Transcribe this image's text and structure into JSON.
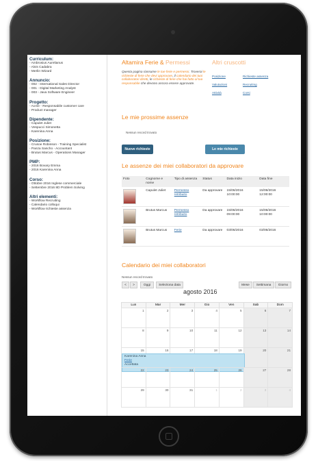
{
  "sidebar": {
    "sections": [
      {
        "title": "Curriculum:",
        "items": [
          "- Ambrosius Aurelianus",
          "- Alvis Cadabra",
          "- Merlin Wizard"
        ]
      },
      {
        "title": "Annuncio:",
        "items": [
          "- 002 - International Sales Director",
          "- 001 - Digital Marketing Analyst",
          "- 003 - Java Software Engineer"
        ]
      },
      {
        "title": "Progetto:",
        "items": [
          "- Acme - Responsabile customer care",
          "- Product manager"
        ]
      },
      {
        "title": "Dipendente:",
        "items": [
          "- Capulet Juliet",
          "- Vespucci Simonetta",
          "- Karenina Anna"
        ]
      },
      {
        "title": "Posizione:",
        "items": [
          "- Crusoe Robinson - Training Specialist",
          "- Panza Sancho - Accountant",
          "- Brutus Marcus - Operations Manager"
        ]
      },
      {
        "title": "PMP:",
        "items": [
          "- 2016 Bovary Emma",
          "- 2016 Karenina Anna"
        ]
      },
      {
        "title": "Corso:",
        "items": [
          "- Ottobre 2016 Inglese commerciale",
          "- Settembre 2016 8D Problem Solving"
        ]
      },
      {
        "title": "Altri elementi:",
        "items": [
          "- Workflow Recruiting",
          "- Calendario colloqui",
          "- Workflow richieste assenza"
        ]
      }
    ]
  },
  "header": {
    "title_main": "Altamira Ferie &",
    "title_light": "Permessi",
    "other": "Altri cruscotti"
  },
  "description": {
    "before": "Questa pagina riassume",
    "hl1": "le tue ferie e permessi",
    "mid1": ". Troverai",
    "hl2": "le richieste di ferie che devi approvare",
    "mid2": ", il",
    "hl3": "calendario dei tuoi collaboratori diretti",
    "mid3": ", le",
    "hl4": "richieste di ferie che hai fatto al tuo responsabile",
    "after": " che devono ancora essere approvate."
  },
  "links": {
    "col1": [
      "Posizione",
      "Valutazioni",
      "Attività"
    ],
    "col2": [
      "Richieste assenza",
      "Recruiting",
      "Corsi"
    ]
  },
  "upcoming": {
    "title": "Le mie prossime assenze",
    "empty": "Nessun record trovato",
    "btn_new": "Nuove richieste",
    "btn_mine": "Le mie richieste"
  },
  "approvals": {
    "title": "Le assenze dei miei collaboratori da approvare",
    "headers": [
      "Foto",
      "Cognome e nome",
      "Tipo di assenza",
      "Status",
      "Data inizio",
      "Data fine"
    ],
    "rows": [
      {
        "name": "Capulet Juliet",
        "type": "Permesso retribuito",
        "status": "Da approvare",
        "start": "15/06/2016 10:00:00",
        "end": "15/06/2016 12:00:00",
        "photo": "#a2362f"
      },
      {
        "name": "Brutus Marcus",
        "type": "Permesso retribuito",
        "status": "Da approvare",
        "start": "15/06/2016 09:00:00",
        "end": "15/06/2016 10:00:00",
        "photo": "#8a6d55"
      },
      {
        "name": "Brutus Marcus",
        "type": "Ferie",
        "status": "Da approvare",
        "start": "03/06/2016",
        "end": "03/06/2016",
        "photo": "#8a6d55"
      }
    ]
  },
  "calendar": {
    "title": "Calendario dei miei collaboratori",
    "empty": "Nessun record trovato",
    "prev": "<",
    "next": ">",
    "today": "Oggi",
    "select": "Seleziona data",
    "views": [
      "Mese",
      "Settimana",
      "Giorno"
    ],
    "month": "agosto 2016",
    "days": [
      "Lun",
      "Mar",
      "Mer",
      "Gio",
      "Ven",
      "Sab",
      "Dom"
    ],
    "weeks": [
      [
        "1",
        "2",
        "3",
        "4",
        "5",
        "6",
        "7"
      ],
      [
        "8",
        "9",
        "10",
        "11",
        "12",
        "13",
        "14"
      ],
      [
        "15",
        "16",
        "17",
        "18",
        "19",
        "20",
        "21"
      ],
      [
        "22",
        "23",
        "24",
        "25",
        "26",
        "27",
        "28"
      ],
      [
        "29",
        "30",
        "31",
        "1",
        "2",
        "3",
        "4"
      ]
    ],
    "event": {
      "name": "Karenina Anna",
      "type": "Ferie",
      "status": "Accettata"
    }
  }
}
